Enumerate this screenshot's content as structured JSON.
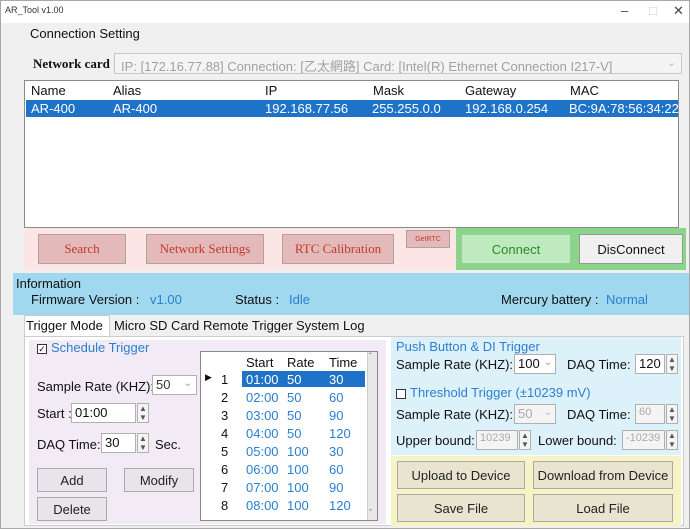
{
  "window": {
    "title": "AR_Tool v1.00"
  },
  "connection": {
    "heading": "Connection Setting",
    "network_label": "Network card :",
    "network_value": "IP: [172.16.77.88] Connection: [乙太網路] Card: [Intel(R) Ethernet Connection I217-V]",
    "columns": [
      "Name",
      "Alias",
      "IP",
      "Mask",
      "Gateway",
      "MAC"
    ],
    "rows": [
      {
        "name": "AR-400",
        "alias": "AR-400",
        "ip": "192.168.77.56",
        "mask": "255.255.0.0",
        "gateway": "192.168.0.254",
        "mac": "BC:9A:78:56:34:22"
      }
    ]
  },
  "buttons": {
    "search": "Search",
    "network_settings": "Network Settings",
    "rtc_calibration": "RTC Calibration",
    "get_rtc": "GetRTC",
    "connect": "Connect",
    "disconnect": "DisConnect"
  },
  "information": {
    "heading": "Information",
    "firmware_label": "Firmware Version :",
    "firmware_value": "v1.00",
    "status_label": "Status :",
    "status_value": "Idle",
    "battery_label": "Mercury battery :",
    "battery_value": "Normal"
  },
  "tabs": [
    "Trigger Mode",
    "Micro SD Card",
    "Remote Trigger",
    "System Log"
  ],
  "schedule": {
    "label": "Schedule Trigger",
    "sample_rate_label": "Sample Rate (KHZ):",
    "sample_rate_value": "50",
    "start_label": "Start :",
    "start_value": "01:00",
    "daq_label": "DAQ Time:",
    "daq_value": "30",
    "daq_unit": "Sec.",
    "add": "Add",
    "modify": "Modify",
    "delete": "Delete"
  },
  "schedule_table": {
    "headers": [
      "Start",
      "Rate",
      "Time"
    ],
    "rows": [
      {
        "idx": "1",
        "start": "01:00",
        "rate": "50",
        "time": "30"
      },
      {
        "idx": "2",
        "start": "02:00",
        "rate": "50",
        "time": "60"
      },
      {
        "idx": "3",
        "start": "03:00",
        "rate": "50",
        "time": "90"
      },
      {
        "idx": "4",
        "start": "04:00",
        "rate": "50",
        "time": "120"
      },
      {
        "idx": "5",
        "start": "05:00",
        "rate": "100",
        "time": "30"
      },
      {
        "idx": "6",
        "start": "06:00",
        "rate": "100",
        "time": "60"
      },
      {
        "idx": "7",
        "start": "07:00",
        "rate": "100",
        "time": "90"
      },
      {
        "idx": "8",
        "start": "08:00",
        "rate": "100",
        "time": "120"
      }
    ]
  },
  "push_button": {
    "label": "Push Button & DI Trigger",
    "sample_rate_label": "Sample Rate (KHZ):",
    "sample_rate_value": "100",
    "daq_label": "DAQ Time:",
    "daq_value": "120"
  },
  "threshold": {
    "label": "Threshold Trigger (±10239 mV)",
    "sample_rate_label": "Sample Rate (KHZ):",
    "sample_rate_value": "50",
    "daq_label": "DAQ Time:",
    "daq_value": "60",
    "upper_label": "Upper bound:",
    "upper_value": "10239",
    "lower_label": "Lower bound:",
    "lower_value": "-10239"
  },
  "file_buttons": {
    "upload": "Upload to Device",
    "download": "Download from Device",
    "save": "Save File",
    "load": "Load File"
  }
}
